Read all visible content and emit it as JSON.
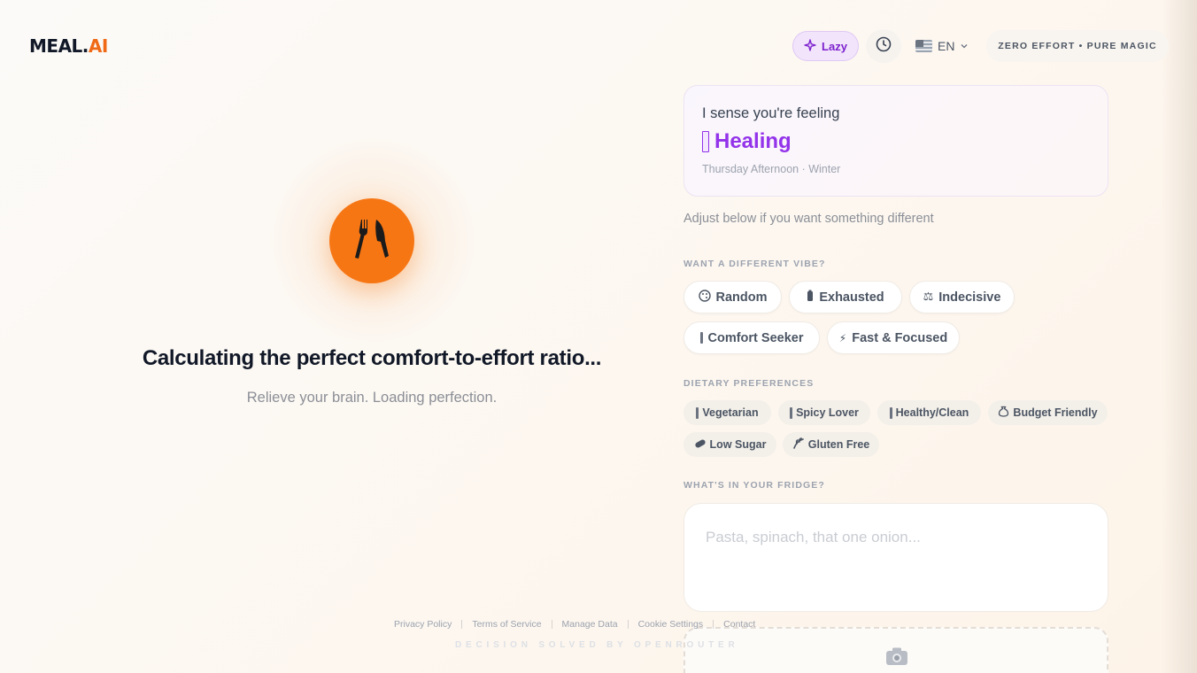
{
  "header": {
    "logo_main": "MEAL.",
    "logo_accent": "AI",
    "lazy_label": "Lazy",
    "language": "EN",
    "tagline": "ZERO EFFORT • PURE MAGIC"
  },
  "loading": {
    "title": "Calculating the perfect comfort-to-effort ratio...",
    "subtitle": "Relieve your brain. Loading perfection."
  },
  "mood": {
    "intro": "I sense you're feeling",
    "name": "Healing",
    "meta": "Thursday Afternoon · Winter",
    "adjust_hint": "Adjust below if you want something different"
  },
  "vibe": {
    "label": "WANT A DIFFERENT VIBE?",
    "options": [
      {
        "label": "Random",
        "icon": "dice-icon"
      },
      {
        "label": "Exhausted",
        "icon": "battery-low-icon"
      },
      {
        "label": "Indecisive",
        "icon": "scales-icon",
        "glyph": "⚖"
      },
      {
        "label": "Comfort Seeker",
        "icon": "comfort-icon"
      },
      {
        "label": "Fast & Focused",
        "icon": "lightning-icon",
        "glyph": "⚡"
      }
    ]
  },
  "dietary": {
    "label": "DIETARY PREFERENCES",
    "options": [
      {
        "label": "Vegetarian",
        "icon": "leaf-icon"
      },
      {
        "label": "Spicy Lover",
        "icon": "pepper-icon"
      },
      {
        "label": "Healthy/Clean",
        "icon": "salad-icon"
      },
      {
        "label": "Budget Friendly",
        "icon": "money-bag-icon"
      },
      {
        "label": "Low Sugar",
        "icon": "no-sugar-icon"
      },
      {
        "label": "Gluten Free",
        "icon": "wheat-icon"
      }
    ]
  },
  "fridge": {
    "label": "WHAT'S IN YOUR FRIDGE?",
    "placeholder": "Pasta, spinach, that one onion..."
  },
  "footer": {
    "links": [
      "Privacy Policy",
      "Terms of Service",
      "Manage Data",
      "Cookie Settings",
      "Contact"
    ],
    "credit": "DECISION SOLVED BY OPENROUTER"
  },
  "colors": {
    "brand_orange": "#f77614",
    "mood_purple": "#9333ea",
    "lazy_bg": "#f1e4fb"
  }
}
